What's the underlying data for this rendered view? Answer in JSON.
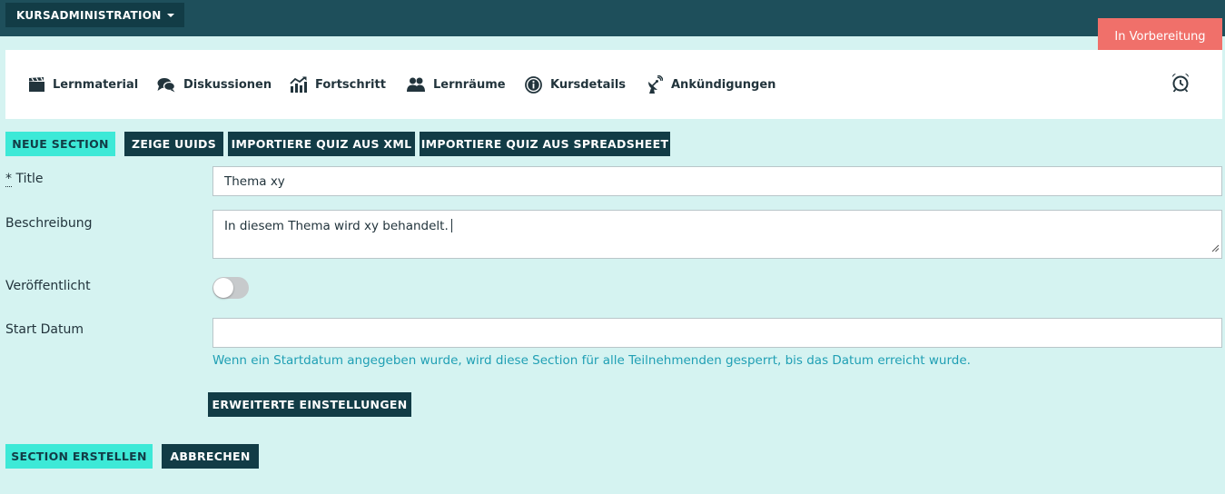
{
  "header": {
    "admin_menu_label": "KURSADMINISTRATION"
  },
  "status_badge": "In Vorbereitung",
  "nav": {
    "items": [
      {
        "label": "Lernmaterial",
        "icon": "clapperboard-icon"
      },
      {
        "label": "Diskussionen",
        "icon": "chat-bubbles-icon"
      },
      {
        "label": "Fortschritt",
        "icon": "chart-up-icon"
      },
      {
        "label": "Lernräume",
        "icon": "users-icon"
      },
      {
        "label": "Kursdetails",
        "icon": "info-icon"
      },
      {
        "label": "Ankündigungen",
        "icon": "satellite-dish-icon"
      }
    ],
    "alarm_icon": "alarm-clock-icon"
  },
  "toolbar": {
    "new_section": "NEUE SECTION",
    "show_uuids": "ZEIGE UUIDS",
    "import_xml": "IMPORTIERE QUIZ AUS XML",
    "import_spreadsheet": "IMPORTIERE QUIZ AUS SPREADSHEET"
  },
  "form": {
    "title_required_marker": "*",
    "title_label": "Title",
    "title_value": "Thema xy",
    "description_label": "Beschreibung",
    "description_value": "In diesem Thema wird xy behandelt.",
    "published_label": "Veröffentlicht",
    "published_on": false,
    "start_date_label": "Start Datum",
    "start_date_value": "",
    "start_date_hint": "Wenn ein Startdatum angegeben wurde, wird diese Section für alle Teilnehmenden gesperrt, bis das Datum erreicht wurde.",
    "advanced_settings": "ERWEITERTE EINSTELLUNGEN"
  },
  "actions": {
    "create": "SECTION ERSTELLEN",
    "cancel": "ABBRECHEN"
  },
  "colors": {
    "background": "#d5f3f1",
    "topbar": "#1e4f5b",
    "dark_button": "#123c46",
    "mint_button": "#3de9d7",
    "status_badge": "#f0706a",
    "hint_text": "#1f9fb4"
  }
}
